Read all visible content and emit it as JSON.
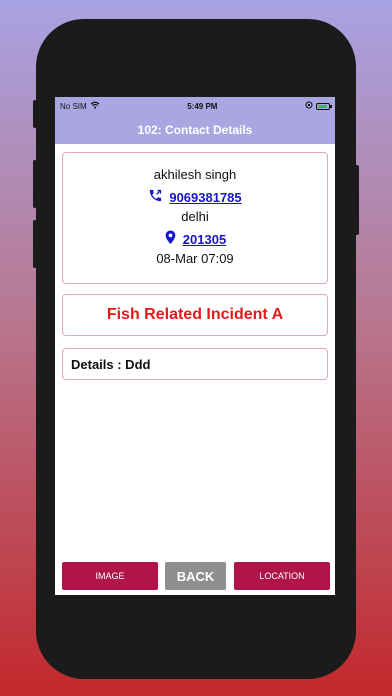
{
  "status_bar": {
    "carrier": "No SIM",
    "time": "5:49 PM"
  },
  "nav": {
    "title": "102: Contact Details"
  },
  "contact": {
    "name": "akhilesh singh",
    "phone": "9069381785",
    "city": "delhi",
    "pincode": "201305",
    "datetime": "08-Mar 07:09"
  },
  "incident": {
    "title": "Fish Related Incident A"
  },
  "details": {
    "label": "Details : Ddd"
  },
  "buttons": {
    "image": "IMAGE",
    "back": "BACK",
    "location": "LOCATION"
  },
  "colors": {
    "nav_bar": "#aaa6e2",
    "incident_text": "#e31a1a",
    "link": "#1515c9",
    "primary_button": "#b0144a",
    "back_button": "#8f8f8f"
  }
}
